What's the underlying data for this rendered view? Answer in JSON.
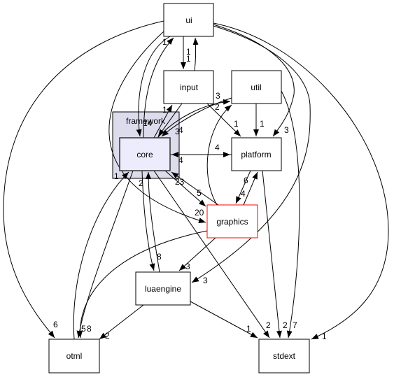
{
  "diagram": {
    "cluster": {
      "id": "framework",
      "label": "framework",
      "fill": "#dcdcec",
      "stroke": "#000000"
    },
    "nodes": [
      {
        "id": "ui",
        "label": "ui",
        "stroke": "#000000",
        "fill": "#ffffff"
      },
      {
        "id": "input",
        "label": "input",
        "stroke": "#000000",
        "fill": "#ffffff"
      },
      {
        "id": "util",
        "label": "util",
        "stroke": "#000000",
        "fill": "#ffffff"
      },
      {
        "id": "core",
        "label": "core",
        "stroke": "#333333",
        "fill": "#ececfc"
      },
      {
        "id": "platform",
        "label": "platform",
        "stroke": "#000000",
        "fill": "#ffffff"
      },
      {
        "id": "graphics",
        "label": "graphics",
        "stroke": "#ff0000",
        "fill": "#ffffff"
      },
      {
        "id": "luaengine",
        "label": "luaengine",
        "stroke": "#000000",
        "fill": "#ffffff"
      },
      {
        "id": "otml",
        "label": "otml",
        "stroke": "#000000",
        "fill": "#ffffff"
      },
      {
        "id": "stdext",
        "label": "stdext",
        "stroke": "#000000",
        "fill": "#ffffff"
      }
    ],
    "edges": [
      {
        "from": "ui",
        "to": "input",
        "label": "1"
      },
      {
        "from": "input",
        "to": "ui",
        "label": "1"
      },
      {
        "from": "ui",
        "to": "core",
        "label": "14"
      },
      {
        "from": "core",
        "to": "ui",
        "label": "1"
      },
      {
        "from": "ui",
        "to": "otml",
        "label": "6"
      },
      {
        "from": "ui",
        "to": "platform",
        "label": "3"
      },
      {
        "from": "ui",
        "to": "graphics",
        "label": "20"
      },
      {
        "from": "ui",
        "to": "luaengine",
        "label": "3"
      },
      {
        "from": "ui",
        "to": "stdext",
        "label": "1"
      },
      {
        "from": "input",
        "to": "core",
        "label": "3"
      },
      {
        "from": "core",
        "to": "input",
        "label": "1"
      },
      {
        "from": "input",
        "to": "platform",
        "label": "1"
      },
      {
        "from": "core",
        "to": "util",
        "label": "3"
      },
      {
        "from": "util",
        "to": "core",
        "label": "4"
      },
      {
        "from": "util",
        "to": "platform",
        "label": "1"
      },
      {
        "from": "util",
        "to": "stdext",
        "label": "7"
      },
      {
        "from": "core",
        "to": "platform",
        "label": "4"
      },
      {
        "from": "platform",
        "to": "core",
        "label": "4"
      },
      {
        "from": "graphics",
        "to": "util",
        "label": "2"
      },
      {
        "from": "core",
        "to": "graphics",
        "label": "5"
      },
      {
        "from": "graphics",
        "to": "core",
        "label": "23"
      },
      {
        "from": "platform",
        "to": "graphics",
        "label": "4"
      },
      {
        "from": "graphics",
        "to": "platform",
        "label": "6"
      },
      {
        "from": "platform",
        "to": "stdext",
        "label": "2"
      },
      {
        "from": "graphics",
        "to": "luaengine",
        "label": "3"
      },
      {
        "from": "graphics",
        "to": "otml",
        "label": "8"
      },
      {
        "from": "core",
        "to": "luaengine",
        "label": "8"
      },
      {
        "from": "luaengine",
        "to": "core",
        "label": "2"
      },
      {
        "from": "core",
        "to": "otml",
        "label": "5"
      },
      {
        "from": "otml",
        "to": "core",
        "label": "1"
      },
      {
        "from": "core",
        "to": "stdext",
        "label": "2"
      },
      {
        "from": "luaengine",
        "to": "otml",
        "label": "2"
      },
      {
        "from": "luaengine",
        "to": "stdext",
        "label": "1"
      }
    ]
  }
}
